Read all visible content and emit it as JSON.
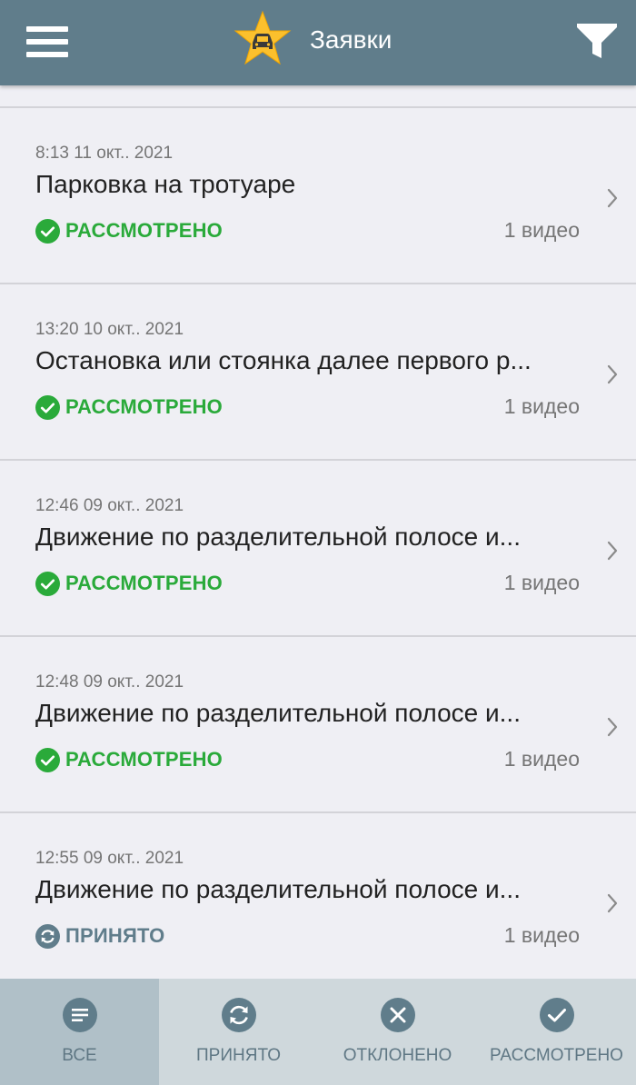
{
  "header": {
    "title": "Заявки",
    "menu_icon": "hamburger-menu-icon",
    "logo_icon": "star-car-logo-icon",
    "filter_icon": "filter-funnel-icon",
    "bar_color": "#607d8b",
    "logo_color": "#fbc02d"
  },
  "requests": [
    {
      "time": "8:13 11 окт.. 2021",
      "title": "Парковка на тротуаре",
      "status": "РАССМОТРЕНО",
      "count": "1 видео"
    },
    {
      "time": "13:20 10 окт.. 2021",
      "title": "Остановка или стоянка далее первого р...",
      "status": "РАССМОТРЕНО",
      "count": "1 видео"
    },
    {
      "time": "12:46 09 окт.. 2021",
      "title": "Движение по разделительной полосе и...",
      "status": "РАССМОТРЕНО",
      "count": "1 видео"
    },
    {
      "time": "12:48 09 окт.. 2021",
      "title": "Движение по разделительной полосе и...",
      "status": "РАССМОТРЕНО",
      "count": "1 видео"
    },
    {
      "time": "12:55 09 окт.. 2021",
      "title": "Движение по разделительной полосе и...",
      "status": "ПРИНЯТО",
      "count": "1 видео"
    }
  ],
  "status_colors": {
    "reviewed": "#2aaa3a",
    "accepted": "#607d8b"
  },
  "tabs": [
    {
      "label": "ВСЕ",
      "icon": "list-icon",
      "active": true
    },
    {
      "label": "ПРИНЯТО",
      "icon": "refresh-icon",
      "active": false
    },
    {
      "label": "ОТКЛОНЕНО",
      "icon": "cancel-icon",
      "active": false
    },
    {
      "label": "РАССМОТРЕНО",
      "icon": "check-circle-icon",
      "active": false
    }
  ]
}
